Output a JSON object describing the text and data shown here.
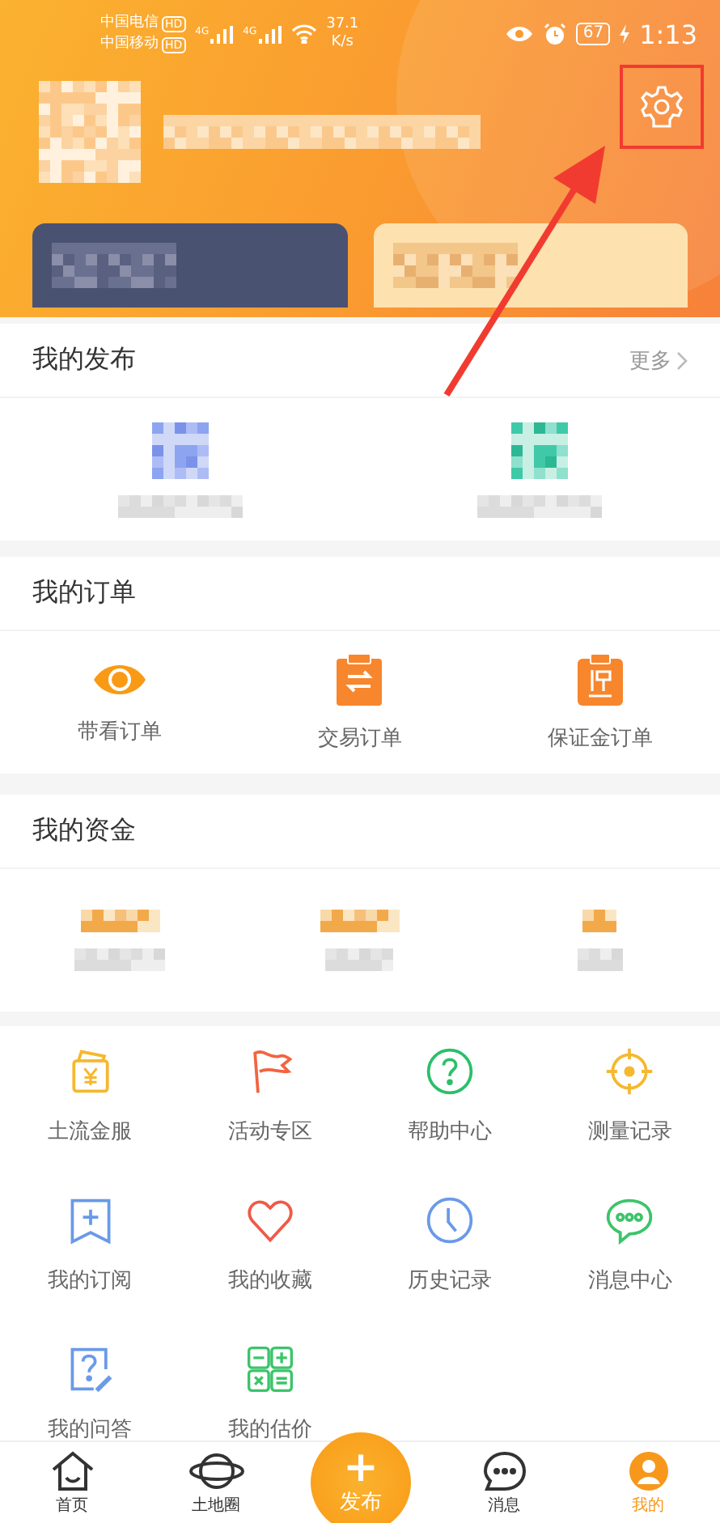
{
  "status_bar": {
    "carrier_1": "中国电信",
    "carrier_1_badge": "HD",
    "carrier_2": "中国移动",
    "carrier_2_badge": "HD",
    "signal_1": "4G",
    "signal_2": "4G",
    "speed_value": "37.1",
    "speed_unit": "K/s",
    "battery": "67",
    "time": "1:13"
  },
  "sections": [
    {
      "title": "我的发布",
      "more": "更多"
    },
    {
      "title": "我的订单",
      "items": [
        "带看订单",
        "交易订单",
        "保证金订单"
      ]
    },
    {
      "title": "我的资金"
    }
  ],
  "services": [
    "土流金服",
    "活动专区",
    "帮助中心",
    "测量记录",
    "我的订阅",
    "我的收藏",
    "历史记录",
    "消息中心",
    "我的问答",
    "我的估价"
  ],
  "bottom_nav": [
    {
      "label": "首页",
      "selected": false
    },
    {
      "label": "土地圈",
      "selected": false
    },
    {
      "label": "消息",
      "selected": false
    },
    {
      "label": "我的",
      "selected": true
    }
  ],
  "publish": {
    "icon": "+",
    "label": "发布"
  }
}
